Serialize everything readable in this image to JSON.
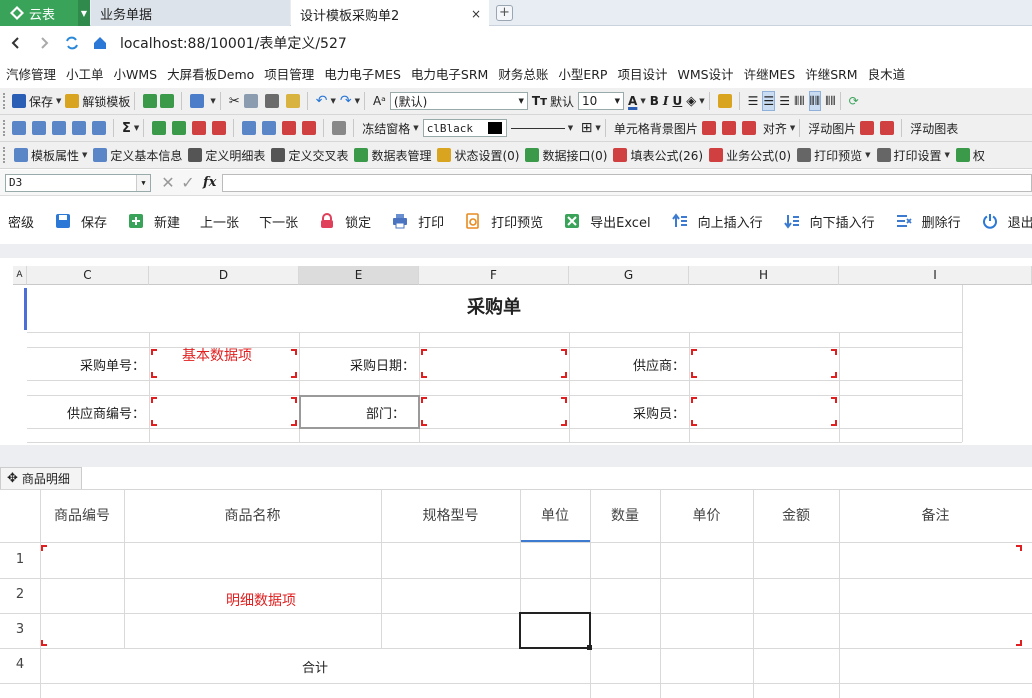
{
  "tabs": {
    "app": "云表",
    "tab1": "业务单据",
    "tab2": "设计模板采购单2",
    "close": "×",
    "new": "+"
  },
  "nav": {
    "url": "localhost:88/10001/表单定义/527"
  },
  "bookmarks": [
    "汽修管理",
    "小工单",
    "小WMS",
    "大屏看板Demo",
    "项目管理",
    "电力电子MES",
    "电力电子SRM",
    "财务总账",
    "小型ERP",
    "项目设计",
    "WMS设计",
    "许继MES",
    "许继SRM",
    "良木道"
  ],
  "toolbar1": {
    "save": "保存",
    "unlock": "解锁模板",
    "font": "(默认)",
    "fontLabel": "默认",
    "size": "10"
  },
  "toolbar2": {
    "freeze": "冻结窗格",
    "color": "clBlack",
    "cellbg": "单元格背景图片",
    "align": "对齐",
    "float": "浮动图片",
    "float2": "浮动图表"
  },
  "toolbar3": {
    "items": [
      "模板属性",
      "定义基本信息",
      "定义明细表",
      "定义交叉表",
      "数据表管理",
      "状态设置(0)",
      "数据接口(0)",
      "填表公式(26)",
      "业务公式(0)",
      "打印预览",
      "打印设置",
      "权"
    ]
  },
  "formula": {
    "cell": "D3",
    "fx": "fx"
  },
  "actions": [
    {
      "label": "密级",
      "icon": "none"
    },
    {
      "label": "保存",
      "icon": "save-icon"
    },
    {
      "label": "新建",
      "icon": "add-icon"
    },
    {
      "label": "上一张",
      "icon": "none"
    },
    {
      "label": "下一张",
      "icon": "none"
    },
    {
      "label": "锁定",
      "icon": "lock-icon"
    },
    {
      "label": "打印",
      "icon": "print-icon"
    },
    {
      "label": "打印预览",
      "icon": "preview-icon"
    },
    {
      "label": "导出Excel",
      "icon": "excel-icon"
    },
    {
      "label": "向上插入行",
      "icon": "insert-up-icon"
    },
    {
      "label": "向下插入行",
      "icon": "insert-down-icon"
    },
    {
      "label": "删除行",
      "icon": "delete-row-icon"
    },
    {
      "label": "退出",
      "icon": "exit-icon"
    }
  ],
  "sheet": {
    "columns": [
      "C",
      "D",
      "E",
      "F",
      "G",
      "H",
      "I"
    ],
    "corner": "A",
    "title": "采购单",
    "labels": {
      "po_no": "采购单号：",
      "po_date": "采购日期：",
      "supplier": "供应商：",
      "supplier_no": "供应商编号：",
      "dept": "部门：",
      "buyer": "采购员："
    },
    "basic_hint": "基本数据项"
  },
  "detail": {
    "tab": "商品明细",
    "headers": [
      "商品编号",
      "商品名称",
      "规格型号",
      "单位",
      "数量",
      "单价",
      "金额",
      "备注"
    ],
    "rows": [
      "1",
      "2",
      "3",
      "4"
    ],
    "hint": "明细数据项",
    "total": "合计"
  },
  "colors": {
    "green": "#3aa35a",
    "blue": "#2b78d6",
    "red": "#e02020"
  }
}
